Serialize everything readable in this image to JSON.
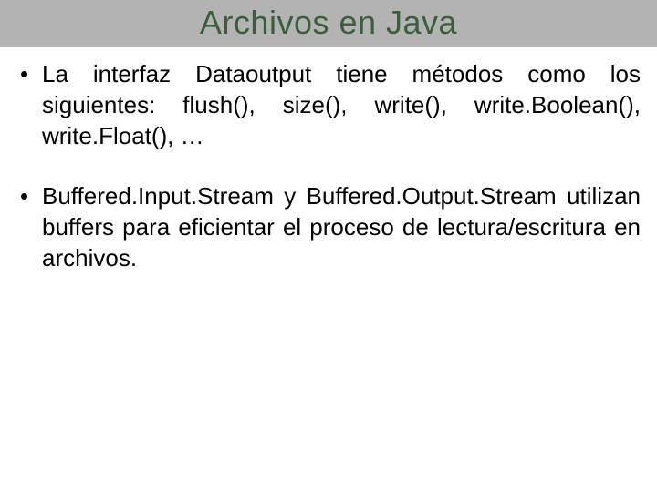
{
  "title": "Archivos en Java",
  "bullets": [
    "La interfaz Dataoutput tiene métodos como los siguientes: flush(), size(), write(), write.Boolean(), write.Float(), …",
    "Buffered.Input.Stream y Buffered.Output.Stream utilizan buffers para eficientar el proceso de lectura/escritura en archivos."
  ]
}
